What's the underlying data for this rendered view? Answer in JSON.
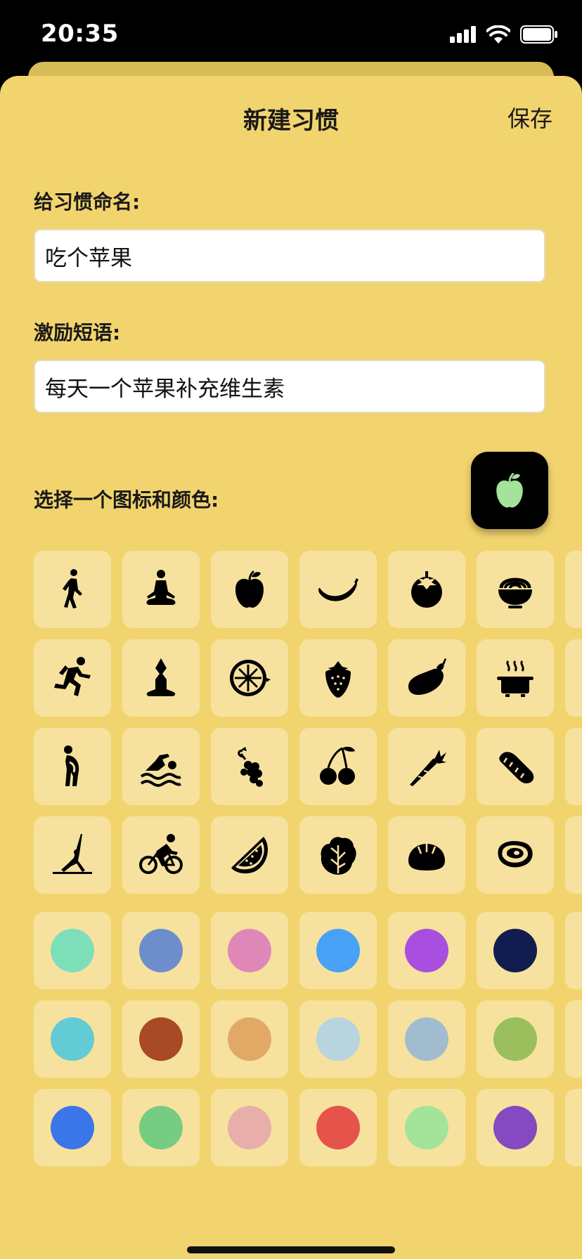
{
  "status_bar": {
    "time": "20:35"
  },
  "header": {
    "title": "新建习惯",
    "save_label": "保存"
  },
  "form": {
    "name_label": "给习惯命名:",
    "name_value": "吃个苹果",
    "motto_label": "激励短语:",
    "motto_value": "每天一个苹果补充维生素",
    "picker_label": "选择一个图标和颜色:"
  },
  "selected": {
    "icon": "apple-icon",
    "color": "#a3e39a"
  },
  "icons": [
    [
      "walking-icon",
      "meditation-icon",
      "apple-icon",
      "banana-icon",
      "tomato-icon",
      "noodle-bowl-icon"
    ],
    [
      "running-icon",
      "yoga-pose-icon",
      "lemon-slice-icon",
      "strawberry-icon",
      "eggplant-icon",
      "cooking-pot-icon"
    ],
    [
      "stretching-icon",
      "swimming-icon",
      "grapes-icon",
      "cherries-icon",
      "carrot-icon",
      "bread-icon"
    ],
    [
      "side-stretch-icon",
      "cycling-icon",
      "watermelon-icon",
      "lettuce-icon",
      "dumpling-icon",
      "steak-icon"
    ]
  ],
  "colors": [
    [
      "#7ddfba",
      "#6e8ecb",
      "#df88b8",
      "#47a2f5",
      "#a84fe0",
      "#121d4f"
    ],
    [
      "#63cbd3",
      "#a84a26",
      "#e2a966",
      "#b7d4df",
      "#a2bccf",
      "#9bbf5c"
    ],
    [
      "#3a76e8",
      "#76cc82",
      "#e7aeaa",
      "#e5534b",
      "#a3e39a",
      "#8549c0"
    ]
  ]
}
